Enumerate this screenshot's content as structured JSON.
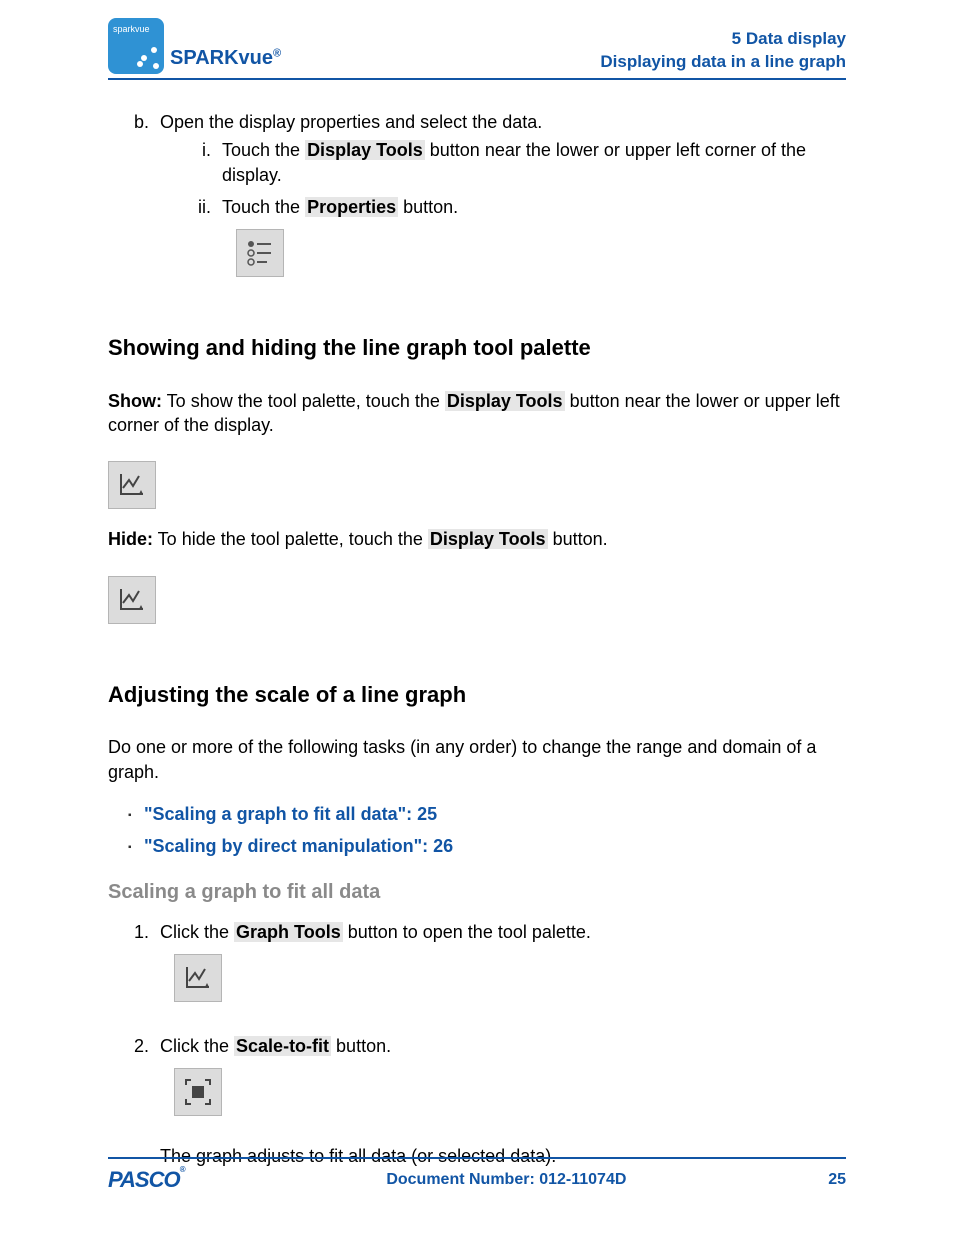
{
  "header": {
    "logo_text": "sparkvue",
    "brand": "SPARKvue",
    "brand_sup": "®",
    "chapter": "5   Data display",
    "section": "Displaying data in a line graph"
  },
  "step_b": {
    "text": "Open the display properties and select the data.",
    "i_pre": "Touch the ",
    "i_hl": "Display Tools",
    "i_post": " button near the lower or upper left corner of the display.",
    "ii_pre": "Touch the ",
    "ii_hl": "Properties",
    "ii_post": " button."
  },
  "sec1": {
    "title": "Showing and hiding the line graph tool palette",
    "show_label": "Show:",
    "show_pre": " To show the tool palette, touch the ",
    "show_hl": "Display Tools",
    "show_post": " button near the lower or upper left corner of the display.",
    "hide_label": "Hide:",
    "hide_pre": " To hide the tool palette, touch the ",
    "hide_hl": "Display Tools",
    "hide_post": " button."
  },
  "sec2": {
    "title": "Adjusting the scale of a line graph",
    "intro": "Do one or more of the following tasks (in any order) to change the range and domain of a graph.",
    "link1": "\"Scaling a graph to fit all data\":  25",
    "link2": "\"Scaling by direct manipulation\":  26",
    "sub_title": "Scaling a graph to fit all data",
    "s1_pre": "Click the ",
    "s1_hl": "Graph Tools",
    "s1_post": " button to open the tool palette.",
    "s2_pre": "Click the ",
    "s2_hl": "Scale-to-fit",
    "s2_post": " button.",
    "s2_result": "The graph adjusts to fit all data (or selected data)."
  },
  "footer": {
    "brand": "PASCO",
    "doc": "Document Number: 012-11074D",
    "page": "25"
  }
}
